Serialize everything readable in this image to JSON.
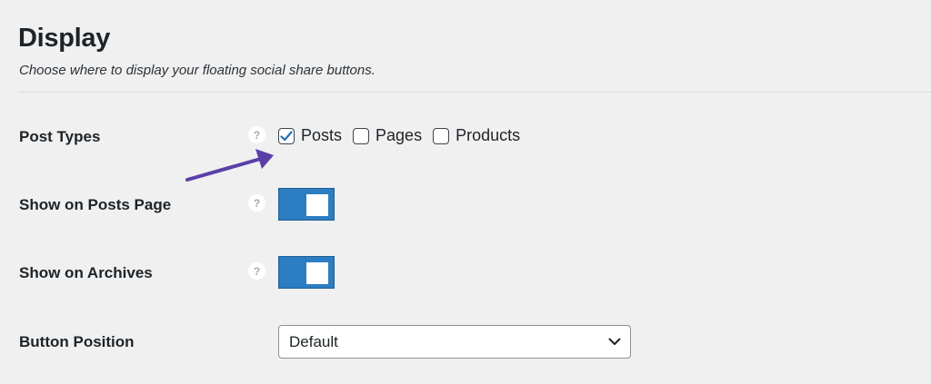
{
  "section": {
    "title": "Display",
    "description": "Choose where to display your floating social share buttons."
  },
  "post_types": {
    "label": "Post Types",
    "help": "?",
    "options": [
      {
        "label": "Posts",
        "checked": true
      },
      {
        "label": "Pages",
        "checked": false
      },
      {
        "label": "Products",
        "checked": false
      }
    ]
  },
  "show_on_posts_page": {
    "label": "Show on Posts Page",
    "help": "?",
    "enabled": true
  },
  "show_on_archives": {
    "label": "Show on Archives",
    "help": "?",
    "enabled": true
  },
  "button_position": {
    "label": "Button Position",
    "selected": "Default"
  },
  "colors": {
    "accent": "#2c7dc1",
    "annotation_arrow": "#5b3fa8",
    "background": "#f0f0f1"
  },
  "icons": {
    "help": "question-mark-icon",
    "check": "checkmark-icon",
    "select": "chevron-down-icon",
    "annotation": "arrow-icon"
  }
}
